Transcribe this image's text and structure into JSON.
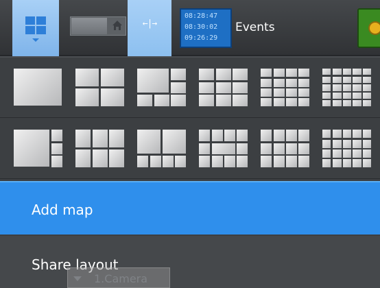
{
  "toolbar": {
    "events_times": [
      "08:28:47",
      "08:30:02",
      "09:26:29"
    ],
    "events_label": "Events",
    "drag_glyph": "←|→"
  },
  "menu": {
    "layout_rows": [
      [
        {
          "name": "layout-1x1",
          "cells": [
            [
              0,
              0,
              1,
              1
            ]
          ]
        },
        {
          "name": "layout-2x2",
          "cells": [
            [
              0,
              0,
              0.5,
              0.5
            ],
            [
              0.5,
              0,
              0.5,
              0.5
            ],
            [
              0,
              0.5,
              0.5,
              0.5
            ],
            [
              0.5,
              0.5,
              0.5,
              0.5
            ]
          ]
        },
        {
          "name": "layout-1-plus-5",
          "cells": [
            [
              0,
              0,
              0.667,
              0.667
            ],
            [
              0.667,
              0,
              0.333,
              0.333
            ],
            [
              0.667,
              0.333,
              0.333,
              0.333
            ],
            [
              0,
              0.667,
              0.333,
              0.333
            ],
            [
              0.333,
              0.667,
              0.333,
              0.333
            ],
            [
              0.667,
              0.667,
              0.333,
              0.333
            ]
          ]
        },
        {
          "name": "layout-3x3",
          "grid": [
            3,
            3
          ]
        },
        {
          "name": "layout-4x4",
          "grid": [
            4,
            4
          ]
        },
        {
          "name": "layout-5x5",
          "grid": [
            5,
            5
          ]
        }
      ],
      [
        {
          "name": "layout-wide-plus-3",
          "cells": [
            [
              0,
              0,
              0.75,
              1
            ],
            [
              0.75,
              0,
              0.25,
              0.333
            ],
            [
              0.75,
              0.333,
              0.25,
              0.333
            ],
            [
              0.75,
              0.667,
              0.25,
              0.333
            ]
          ]
        },
        {
          "name": "layout-3x2",
          "grid": [
            3,
            2
          ]
        },
        {
          "name": "layout-wide-2-plus-4",
          "cells": [
            [
              0,
              0,
              0.5,
              0.667
            ],
            [
              0.5,
              0,
              0.5,
              0.667
            ],
            [
              0,
              0.667,
              0.25,
              0.333
            ],
            [
              0.25,
              0.667,
              0.25,
              0.333
            ],
            [
              0.5,
              0.667,
              0.25,
              0.333
            ],
            [
              0.75,
              0.667,
              0.25,
              0.333
            ]
          ]
        },
        {
          "name": "layout-wide-plus-8",
          "cells": [
            [
              0.25,
              0.333,
              0.5,
              0.333
            ],
            [
              0,
              0,
              0.25,
              0.333
            ],
            [
              0.25,
              0,
              0.25,
              0.333
            ],
            [
              0.5,
              0,
              0.25,
              0.333
            ],
            [
              0.75,
              0,
              0.25,
              0.333
            ],
            [
              0,
              0.333,
              0.25,
              0.333
            ],
            [
              0.75,
              0.333,
              0.25,
              0.333
            ],
            [
              0,
              0.667,
              0.25,
              0.333
            ],
            [
              0.25,
              0.667,
              0.25,
              0.333
            ],
            [
              0.5,
              0.667,
              0.25,
              0.333
            ],
            [
              0.75,
              0.667,
              0.25,
              0.333
            ]
          ]
        },
        {
          "name": "layout-4x3",
          "grid": [
            4,
            3
          ]
        },
        {
          "name": "layout-5x4",
          "grid": [
            5,
            4
          ]
        }
      ]
    ],
    "add_map": "Add map",
    "share_layout": "Share layout",
    "camera_tab": "1.Camera"
  },
  "colors": {
    "accent": "#2f8fec",
    "toolbar_button": "#a8d0f6",
    "events_bg": "#1e6fc4",
    "status_green": "#3a8a21"
  },
  "icons": {
    "layouts": "grid-icon",
    "home": "home-icon",
    "drag": "resize-arrows-icon",
    "status": "status-icon"
  }
}
